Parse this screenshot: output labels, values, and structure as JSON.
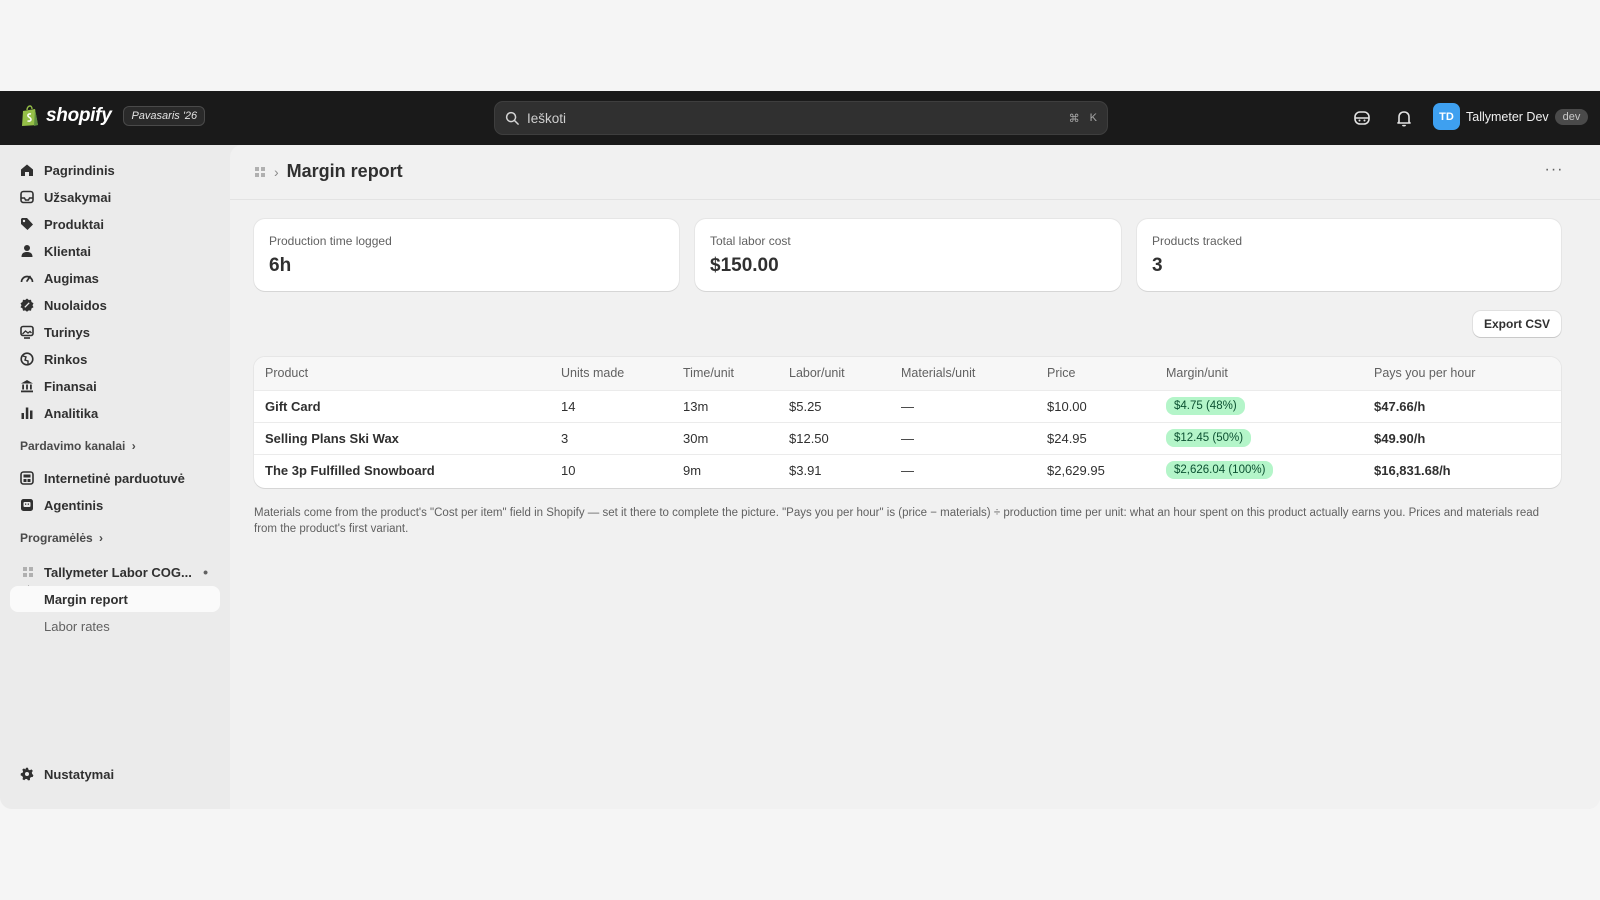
{
  "topbar": {
    "logo_text": "shopify",
    "edition": "Pavasaris '26",
    "search_placeholder": "Ieškoti",
    "search_shortcut_cmd": "⌘",
    "search_shortcut_key": "K",
    "avatar_initials": "TD",
    "account_name": "Tallymeter Dev",
    "store_badge": "dev"
  },
  "sidebar": {
    "items": [
      {
        "label": "Pagrindinis",
        "icon": "home-icon"
      },
      {
        "label": "Užsakymai",
        "icon": "inbox-icon"
      },
      {
        "label": "Produktai",
        "icon": "tag-icon"
      },
      {
        "label": "Klientai",
        "icon": "person-icon"
      },
      {
        "label": "Augimas",
        "icon": "gauge-icon"
      },
      {
        "label": "Nuolaidos",
        "icon": "discount-icon"
      },
      {
        "label": "Turinys",
        "icon": "content-icon"
      },
      {
        "label": "Rinkos",
        "icon": "globe-icon"
      },
      {
        "label": "Finansai",
        "icon": "bank-icon"
      },
      {
        "label": "Analitika",
        "icon": "bar-chart-icon"
      }
    ],
    "sales_channels_heading": "Pardavimo kanalai",
    "sales_channels": [
      {
        "label": "Internetinė parduotuvė",
        "icon": "store-icon"
      },
      {
        "label": "Agentinis",
        "icon": "agent-icon"
      }
    ],
    "apps_heading": "Programėlės",
    "app_name": "Tallymeter Labor COG...",
    "app_subitems": [
      "Margin report",
      "Labor rates"
    ],
    "settings_label": "Nustatymai"
  },
  "page": {
    "title": "Margin report",
    "stats": [
      {
        "label": "Production time logged",
        "value": "6h"
      },
      {
        "label": "Total labor cost",
        "value": "$150.00"
      },
      {
        "label": "Products tracked",
        "value": "3"
      }
    ],
    "export_label": "Export CSV",
    "table": {
      "columns": [
        "Product",
        "Units made",
        "Time/unit",
        "Labor/unit",
        "Materials/unit",
        "Price",
        "Margin/unit",
        "Pays you per hour"
      ],
      "rows": [
        [
          "Gift Card",
          "14",
          "13m",
          "$5.25",
          "—",
          "$10.00",
          "$4.75 (48%)",
          "$47.66/h"
        ],
        [
          "Selling Plans Ski Wax",
          "3",
          "30m",
          "$12.50",
          "—",
          "$24.95",
          "$12.45 (50%)",
          "$49.90/h"
        ],
        [
          "The 3p Fulfilled Snowboard",
          "10",
          "9m",
          "$3.91",
          "—",
          "$2,629.95",
          "$2,626.04 (100%)",
          "$16,831.68/h"
        ]
      ]
    },
    "footnote": "Materials come from the product's \"Cost per item\" field in Shopify — set it there to complete the picture. \"Pays you per hour\" is (price − materials) ÷ production time per unit: what an hour spent on this product actually earns you. Prices and materials read from the product's first variant."
  },
  "colors": {
    "topbar_bg": "#1a1a1a",
    "avatar_bg": "#3ea0f0",
    "margin_badge_bg": "#b4f5c9",
    "margin_badge_text": "#0c5132"
  }
}
